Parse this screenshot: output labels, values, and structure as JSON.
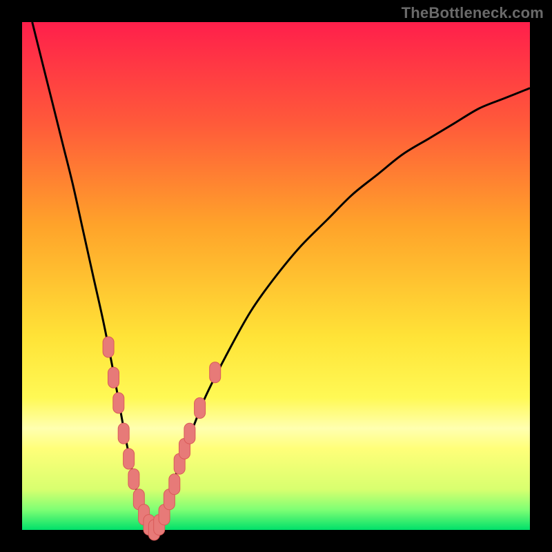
{
  "watermark": "TheBottleneck.com",
  "gradient": {
    "stops": [
      {
        "pct": 0,
        "color": "#ff1f4b"
      },
      {
        "pct": 20,
        "color": "#ff5a3a"
      },
      {
        "pct": 40,
        "color": "#ffa32a"
      },
      {
        "pct": 62,
        "color": "#ffe337"
      },
      {
        "pct": 74,
        "color": "#fff955"
      },
      {
        "pct": 80,
        "color": "#ffffb0"
      },
      {
        "pct": 84,
        "color": "#ffff79"
      },
      {
        "pct": 92,
        "color": "#d8ff6f"
      },
      {
        "pct": 96,
        "color": "#7fff74"
      },
      {
        "pct": 100,
        "color": "#00e06a"
      }
    ]
  },
  "colors": {
    "curve": "#000000",
    "marker_fill": "#e77a78",
    "marker_stroke": "#d95a58",
    "plot_border": "#000000"
  },
  "chart_data": {
    "type": "line",
    "title": "",
    "xlabel": "",
    "ylabel": "",
    "xlim": [
      0,
      100
    ],
    "ylim": [
      0,
      100
    ],
    "series": [
      {
        "name": "bottleneck-curve",
        "note": "V-shaped bottleneck curve; valley bottom near x≈25, y≈0; rises steeply left and more gently right.",
        "x": [
          2,
          4,
          6,
          8,
          10,
          12,
          14,
          16,
          18,
          20,
          21,
          22,
          23,
          24,
          25,
          26,
          27,
          28,
          30,
          32,
          34,
          36,
          40,
          45,
          50,
          55,
          60,
          65,
          70,
          75,
          80,
          85,
          90,
          95,
          100
        ],
        "y": [
          100,
          92,
          84,
          76,
          68,
          59,
          50,
          41,
          31,
          20,
          15,
          10,
          6,
          3,
          1,
          0,
          1,
          4,
          10,
          16,
          21,
          26,
          34,
          43,
          50,
          56,
          61,
          66,
          70,
          74,
          77,
          80,
          83,
          85,
          87
        ]
      }
    ],
    "markers": {
      "name": "highlighted-points",
      "note": "Salmon pill-shaped markers clustered along the lower portion of the V.",
      "points": [
        {
          "x": 17,
          "y": 36
        },
        {
          "x": 18,
          "y": 30
        },
        {
          "x": 19,
          "y": 25
        },
        {
          "x": 20,
          "y": 19
        },
        {
          "x": 21,
          "y": 14
        },
        {
          "x": 22,
          "y": 10
        },
        {
          "x": 23,
          "y": 6
        },
        {
          "x": 24,
          "y": 3
        },
        {
          "x": 25,
          "y": 1
        },
        {
          "x": 26,
          "y": 0
        },
        {
          "x": 27,
          "y": 1
        },
        {
          "x": 28,
          "y": 3
        },
        {
          "x": 29,
          "y": 6
        },
        {
          "x": 30,
          "y": 9
        },
        {
          "x": 31,
          "y": 13
        },
        {
          "x": 32,
          "y": 16
        },
        {
          "x": 33,
          "y": 19
        },
        {
          "x": 35,
          "y": 24
        },
        {
          "x": 38,
          "y": 31
        }
      ]
    }
  }
}
